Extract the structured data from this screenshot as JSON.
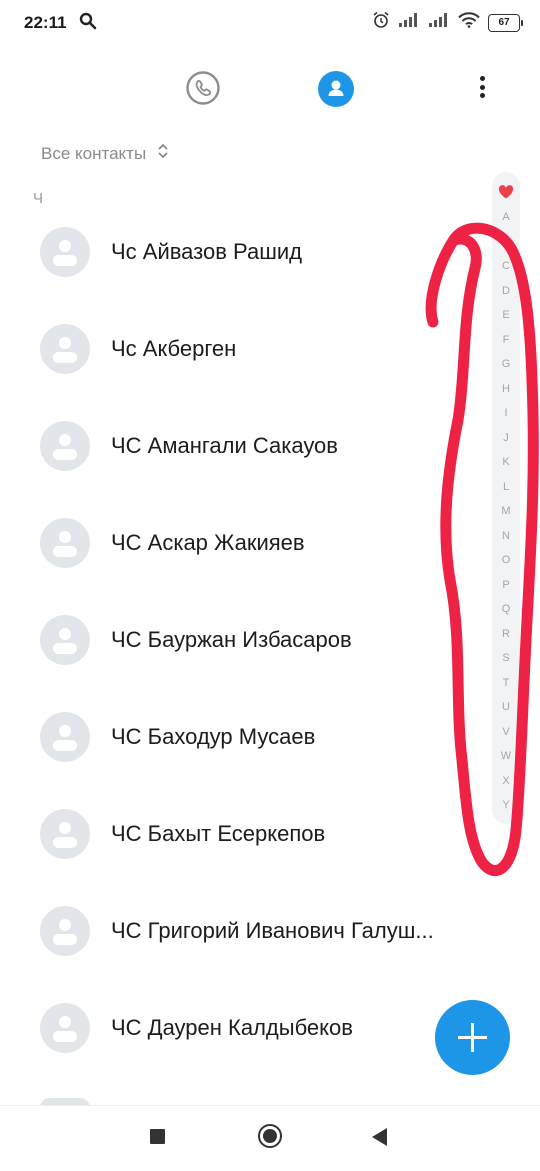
{
  "status_bar": {
    "time": "22:11",
    "battery": "67",
    "icons": [
      "search-icon",
      "alarm-icon",
      "signal-icon",
      "signal-icon",
      "wifi-icon",
      "battery-icon"
    ]
  },
  "header": {
    "tabs": [
      {
        "icon": "phone-icon",
        "active": false
      },
      {
        "icon": "contact-icon",
        "active": true
      }
    ],
    "menu_icon": "more-vertical-icon"
  },
  "filter": {
    "label": "Все контакты",
    "icon": "chevron-up-down-icon"
  },
  "section_letter": "Ч",
  "contacts": [
    {
      "name": "Чс Айвазов Рашид"
    },
    {
      "name": "Чс Акберген"
    },
    {
      "name": "ЧС Амангали Сакауов"
    },
    {
      "name": "ЧС Аскар Жакияев"
    },
    {
      "name": "ЧС Бауржан Избасаров"
    },
    {
      "name": "ЧС Баходур Мусаев"
    },
    {
      "name": "ЧС Бахыт Есеркепов"
    },
    {
      "name": "ЧС Григорий Иванович Галуш..."
    },
    {
      "name": "ЧС Даурен Калдыбеков"
    }
  ],
  "alphabet_index": {
    "favorite_icon": "heart-icon",
    "letters": [
      "A",
      "B",
      "C",
      "D",
      "E",
      "F",
      "G",
      "H",
      "I",
      "J",
      "K",
      "L",
      "M",
      "N",
      "O",
      "P",
      "Q",
      "R",
      "S",
      "T",
      "U",
      "V",
      "W",
      "X",
      "Y"
    ]
  },
  "fab": {
    "icon": "plus-icon"
  },
  "nav_bar": {
    "icons": [
      "square-recents-icon",
      "circle-home-icon",
      "triangle-back-icon"
    ]
  },
  "colors": {
    "accent": "#1e96e8",
    "annotation": "#ee2244",
    "avatar_bg": "#e2e6eb"
  }
}
